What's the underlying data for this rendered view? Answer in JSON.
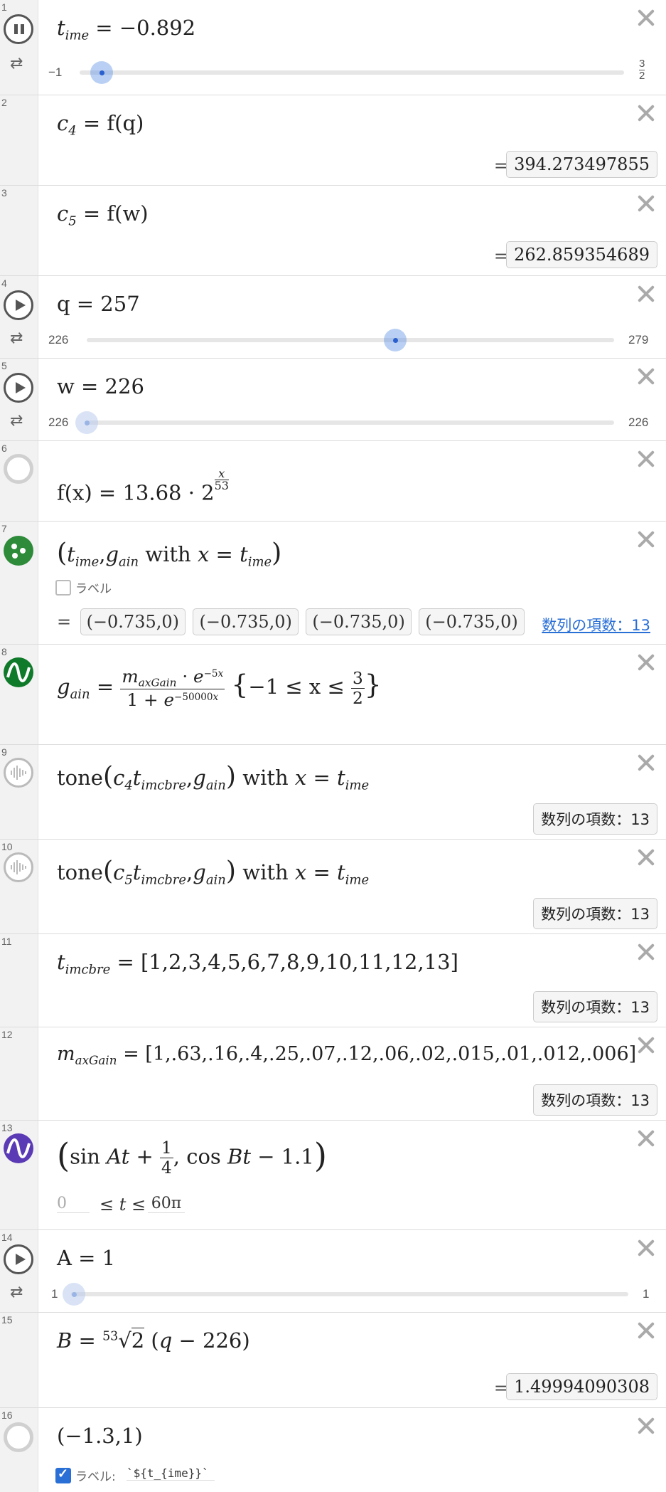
{
  "rows": [
    {
      "num": "1",
      "lhs": "t",
      "lhs_sub": "ime",
      "rhs": "= −0.892",
      "slider": {
        "min": "−1",
        "max_num": "3",
        "max_den": "2",
        "value": -0.892,
        "min_value": -1,
        "max_value": 1.5
      }
    },
    {
      "num": "2",
      "lhs": "c",
      "lhs_sub": "4",
      "rhs": "= f(q)",
      "output": "394.273497855"
    },
    {
      "num": "3",
      "lhs": "c",
      "lhs_sub": "5",
      "rhs": "= f(w)",
      "output": "262.859354689"
    },
    {
      "num": "4",
      "expr": "q = 257",
      "slider": {
        "min": "226",
        "max": "279",
        "value": 257,
        "min_value": 226,
        "max_value": 279
      }
    },
    {
      "num": "5",
      "expr": "w = 226",
      "slider": {
        "min": "226",
        "max": "226",
        "value": 226
      }
    },
    {
      "num": "6",
      "expr_a": "f(x) = 13.68 · 2",
      "exp_num": "x",
      "exp_den": "53"
    },
    {
      "num": "7",
      "label_text": "ラベル",
      "cells": [
        "(−0.735,0)",
        "(−0.735,0)",
        "(−0.735,0)",
        "(−0.735,0)"
      ],
      "seq_link": "数列の項数：13"
    },
    {
      "num": "8",
      "domain_a": "−1 ≤ x ≤",
      "domain_num": "3",
      "domain_den": "2"
    },
    {
      "num": "9",
      "seq": "数列の項数：13"
    },
    {
      "num": "10",
      "seq": "数列の項数：13"
    },
    {
      "num": "11",
      "list": "= [1,2,3,4,5,6,7,8,9,10,11,12,13]",
      "seq": "数列の項数：13"
    },
    {
      "num": "12",
      "list": "= [1,.63,.16,.4,.25,.07,.12,.06,.02,.015,.01,.012,.006]",
      "seq": "数列の項数：13"
    },
    {
      "num": "13",
      "t_min": "0",
      "t_max": "60π"
    },
    {
      "num": "14",
      "expr": "A = 1",
      "slider": {
        "min": "1",
        "max": "1",
        "value": 1
      }
    },
    {
      "num": "15",
      "output": "1.49994090308"
    },
    {
      "num": "16",
      "expr": "(−1.3,1)",
      "label_text": "ラベル:",
      "label_value": "`${t_{ime}}`"
    }
  ],
  "colors": {
    "point_green": "#2e8b3a",
    "curve_green": "#0f7a2a",
    "curve_purple": "#5b3bb5",
    "link_blue": "#2a6fd6",
    "slider_blue": "#2a5fd0"
  },
  "icons": [
    "pause-icon",
    "loop-icon",
    "play-icon",
    "point-icon",
    "curve-icon",
    "audio-icon",
    "delete-icon"
  ]
}
